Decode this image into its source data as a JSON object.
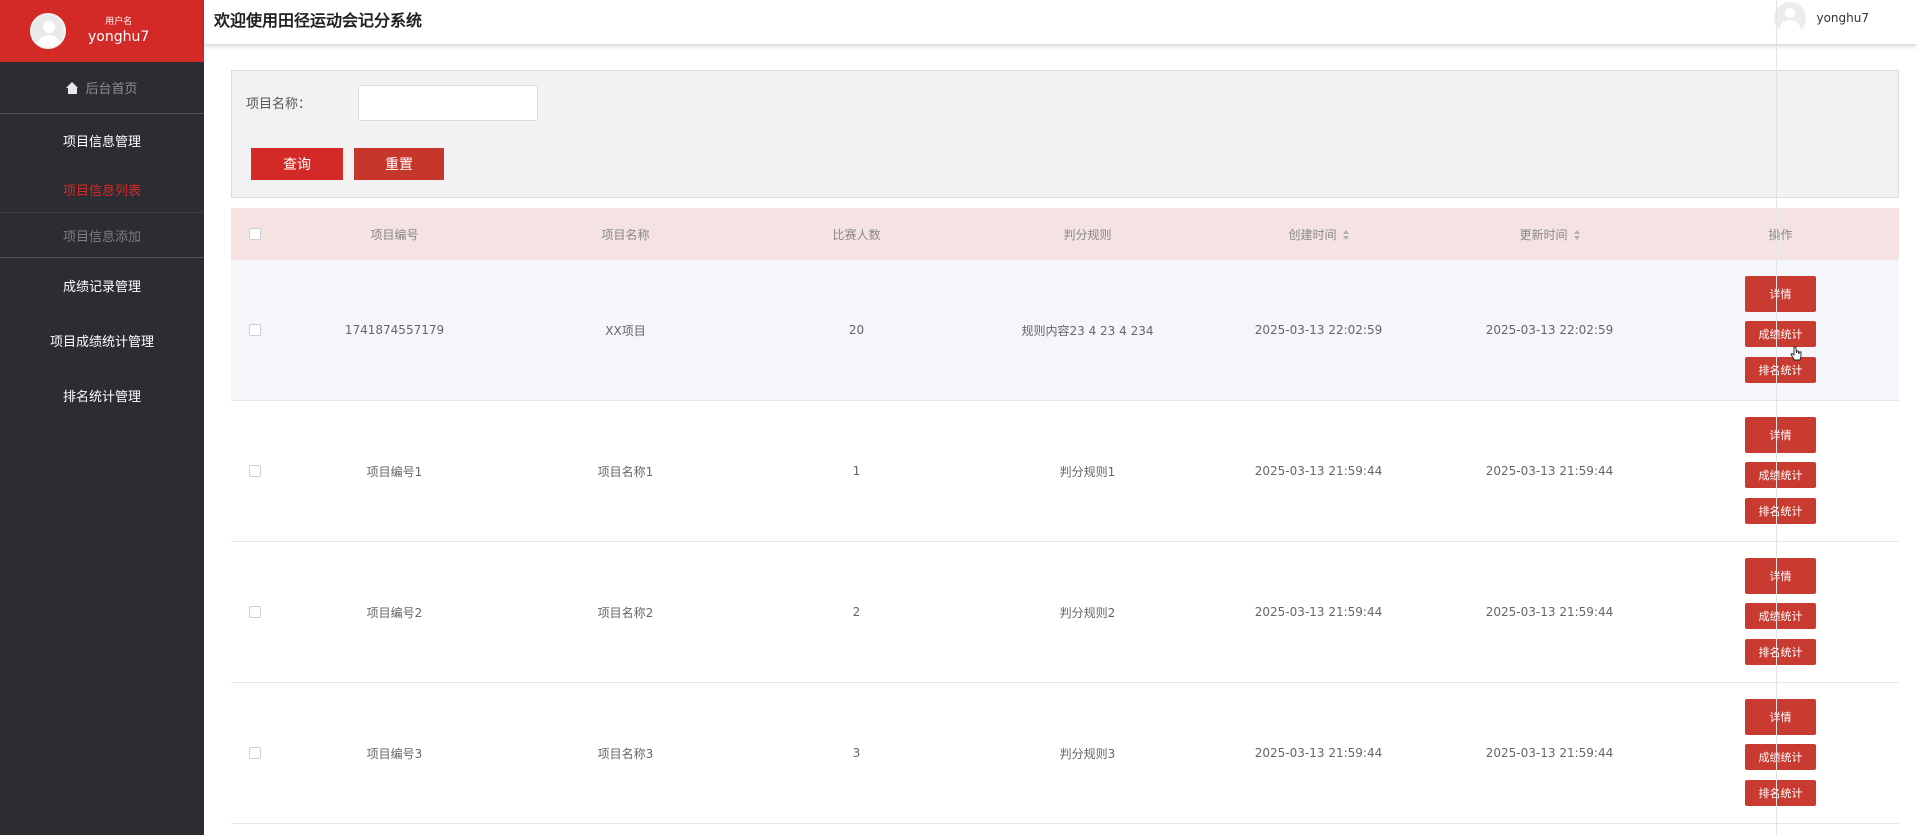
{
  "sidebar": {
    "user_label": "用户名",
    "username": "yonghu7",
    "home": "后台首页",
    "groups": [
      {
        "label": "项目信息管理"
      },
      {
        "label": "项目信息列表"
      },
      {
        "label": "项目信息添加"
      },
      {
        "label": "成绩记录管理"
      },
      {
        "label": "项目成绩统计管理"
      },
      {
        "label": "排名统计管理"
      }
    ]
  },
  "header": {
    "title": "欢迎使用田径运动会记分系统",
    "username": "yonghu7"
  },
  "search": {
    "label": "项目名称：",
    "value": "",
    "placeholder": "",
    "query_label": "查询",
    "reset_label": "重置"
  },
  "table": {
    "headers": [
      "项目编号",
      "项目名称",
      "比赛人数",
      "判分规则",
      "创建时间",
      "更新时间",
      "操作"
    ],
    "rows": [
      {
        "id": "1741874557179",
        "name": "XX项目",
        "count": "20",
        "rule": "规则内容23 4 23 4 234",
        "created": "2025-03-13 22:02:59",
        "updated": "2025-03-13 22:02:59"
      },
      {
        "id": "项目编号1",
        "name": "项目名称1",
        "count": "1",
        "rule": "判分规则1",
        "created": "2025-03-13 21:59:44",
        "updated": "2025-03-13 21:59:44"
      },
      {
        "id": "项目编号2",
        "name": "项目名称2",
        "count": "2",
        "rule": "判分规则2",
        "created": "2025-03-13 21:59:44",
        "updated": "2025-03-13 21:59:44"
      },
      {
        "id": "项目编号3",
        "name": "项目名称3",
        "count": "3",
        "rule": "判分规则3",
        "created": "2025-03-13 21:59:44",
        "updated": "2025-03-13 21:59:44"
      }
    ],
    "actions": {
      "detail": "详情",
      "score_stats": "成绩统计",
      "rank_stats": "排名统计"
    }
  },
  "colors": {
    "accent": "#d32a27",
    "sidebar_bg": "#2b2d32",
    "header_row_bg": "#f5e2e3"
  }
}
